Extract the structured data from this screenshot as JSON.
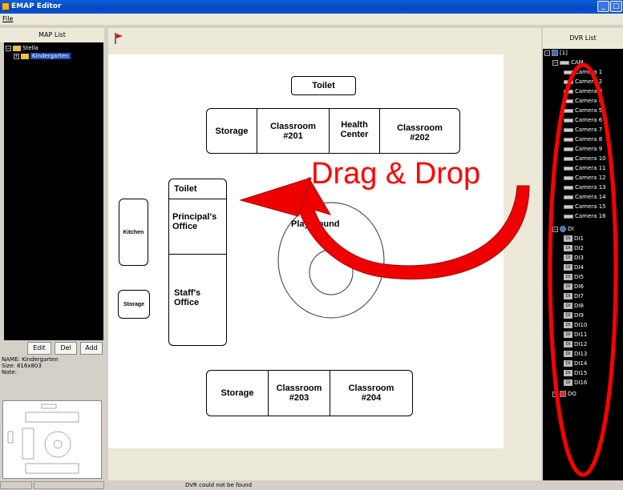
{
  "window": {
    "title": "EMAP Editor"
  },
  "menu": {
    "file": "File"
  },
  "map_list": {
    "header": "MAP List",
    "root": "Stella",
    "child": "Kindergarten",
    "buttons": {
      "edit": "Edit",
      "del": "Del",
      "add": "Add"
    },
    "info": {
      "name": "NAME: Kindergarten",
      "size": "Size: 816x803",
      "note": "Note:"
    }
  },
  "dvr_list": {
    "header": "DVR List",
    "root": "[1]",
    "cam_group": "CAM",
    "cameras": [
      "Camera 1",
      "Camera 2",
      "Camera 3",
      "Camera 4",
      "Camera 5",
      "Camera 6",
      "Camera 7",
      "Camera 8",
      "Camera 9",
      "Camera 10",
      "Camera 11",
      "Camera 12",
      "Camera 13",
      "Camera 14",
      "Camera 15",
      "Camera 16"
    ],
    "di_group": "DI",
    "di_items": [
      "DI1",
      "DI2",
      "DI3",
      "DI4",
      "DI5",
      "DI6",
      "DI7",
      "DI8",
      "DI9",
      "DI10",
      "DI11",
      "DI12",
      "DI13",
      "DI14",
      "DI15",
      "DI16"
    ],
    "do_group": "DO"
  },
  "map": {
    "rooms": {
      "toilet_top": "Toilet",
      "storage_top": "Storage",
      "classroom_201": "Classroom\n#201",
      "health_center": "Health\nCenter",
      "classroom_202": "Classroom\n#202",
      "toilet_left": "Toilet",
      "principals_office": "Principal's\nOffice",
      "staffs_office": "Staff's\nOffice",
      "kitchen": "Kitchen",
      "storage_left": "Storage",
      "playground": "Playground",
      "storage_bottom": "Storage",
      "classroom_203": "Classroom\n#203",
      "classroom_204": "Classroom\n#204"
    }
  },
  "overlay": {
    "drag_drop": "Drag & Drop"
  },
  "status": {
    "message": "DVR could not be found"
  }
}
